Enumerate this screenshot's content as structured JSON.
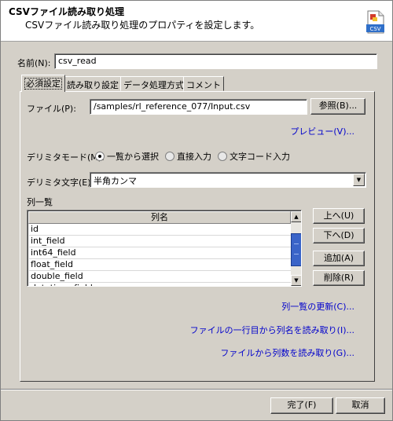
{
  "header": {
    "title": "CSVファイル読み取り処理",
    "description": "CSVファイル読み取り処理のプロパティを設定します。",
    "icon_label": "CSV"
  },
  "name": {
    "label": "名前(N):",
    "value": "csv_read"
  },
  "tabs": [
    {
      "label": "必須設定",
      "active": true
    },
    {
      "label": "読み取り設定",
      "active": false
    },
    {
      "label": "データ処理方式",
      "active": false
    },
    {
      "label": "コメント",
      "active": false
    }
  ],
  "file": {
    "label": "ファイル(P):",
    "value": "/samples/rl_reference_077/Input.csv",
    "browse_label": "参照(B)..."
  },
  "preview_link": "プレビュー(V)...",
  "delimiter_mode": {
    "label": "デリミタモード(M):",
    "options": [
      {
        "label": "一覧から選択",
        "selected": true
      },
      {
        "label": "直接入力",
        "selected": false
      },
      {
        "label": "文字コード入力",
        "selected": false
      }
    ]
  },
  "delimiter_char": {
    "label": "デリミタ文字(E):",
    "value": "半角カンマ"
  },
  "column_list": {
    "label": "列一覧",
    "header": "列名",
    "rows": [
      "id",
      "int_field",
      "int64_field",
      "float_field",
      "double_field",
      "datetime_field"
    ]
  },
  "list_buttons": {
    "up": "上へ(U)",
    "down": "下へ(D)",
    "add": "追加(A)",
    "delete": "削除(R)"
  },
  "links": {
    "refresh": "列一覧の更新(C)...",
    "read_names": "ファイルの一行目から列名を読み取り(I)...",
    "read_count": "ファイルから列数を読み取り(G)..."
  },
  "footer": {
    "ok_label": "完了(F)",
    "cancel_label": "取消"
  }
}
